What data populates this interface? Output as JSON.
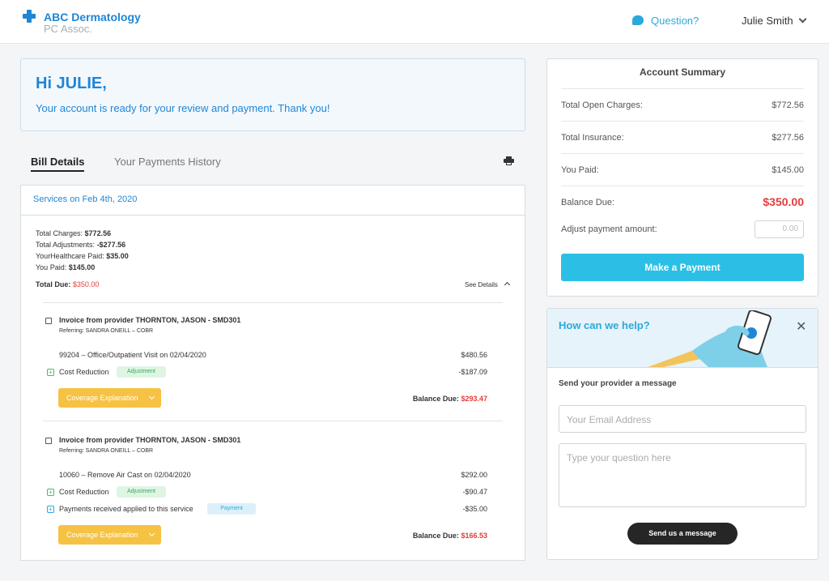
{
  "header": {
    "brand_line1": "ABC Dermatology",
    "brand_line2": "PC Assoc.",
    "question_label": "Question?",
    "user_name": "Julie Smith"
  },
  "greeting": {
    "title": "Hi JULIE,",
    "message": "Your account is ready for your review and payment. Thank you!"
  },
  "tabs": [
    {
      "label": "Bill Details",
      "active": true
    },
    {
      "label": "Your Payments History",
      "active": false
    }
  ],
  "services": {
    "title": "Services on Feb 4th, 2020",
    "totals": [
      {
        "label": "Total Charges:",
        "value": "$772.56"
      },
      {
        "label": "Total Adjustments:",
        "value": "-$277.56"
      },
      {
        "label": "YourHealthcare Paid:",
        "value": "$35.00"
      },
      {
        "label": "You Paid:",
        "value": "$145.00"
      }
    ],
    "total_due_label": "Total Due:",
    "total_due_value": "$350.00",
    "see_details": "See Details",
    "invoices": [
      {
        "title": "Invoice from provider THORNTON, JASON - SMD301",
        "referring": "Referring: SANDRA ONEILL – COBR",
        "service": "99204 – Office/Outpatient Visit on 02/04/2020",
        "service_amount": "$480.56",
        "adjustments": [
          {
            "label": "Cost Reduction",
            "tag": "Adjustment",
            "amount": "-$187.09"
          }
        ],
        "coverage_label": "Coverage Explanation",
        "balance_label": "Balance Due:",
        "balance_value": "$293.47"
      },
      {
        "title": "Invoice from provider THORNTON, JASON - SMD301",
        "referring": "Referring: SANDRA ONEILL – COBR",
        "service": "10060 – Remove Air Cast on 02/04/2020",
        "service_amount": "$292.00",
        "adjustments": [
          {
            "label": "Cost Reduction",
            "tag": "Adjustment",
            "amount": "-$90.47"
          },
          {
            "label": "Payments received applied to this service",
            "tag": "Payment",
            "amount": "-$35.00"
          }
        ],
        "coverage_label": "Coverage Explanation",
        "balance_label": "Balance Due:",
        "balance_value": "$166.53"
      }
    ]
  },
  "account_summary": {
    "title": "Account Summary",
    "rows": [
      {
        "label": "Total Open Charges:",
        "value": "$772.56"
      },
      {
        "label": "Total Insurance:",
        "value": "$277.56"
      },
      {
        "label": "You Paid:",
        "value": "$145.00"
      }
    ],
    "balance_label": "Balance Due:",
    "balance_value": "$350.00",
    "adjust_label": "Adjust payment amount:",
    "adjust_placeholder": "0.00",
    "pay_button": "Make a Payment"
  },
  "help": {
    "title": "How can we help?",
    "send_label": "Send your provider a message",
    "email_placeholder": "Your Email Address",
    "question_placeholder": "Type your question here",
    "send_button": "Send us a message"
  },
  "colors": {
    "brand_blue": "#1f86d6",
    "accent_cyan": "#2bbfe6",
    "due_red": "#e43d3d",
    "coverage_yellow": "#f6c244"
  }
}
